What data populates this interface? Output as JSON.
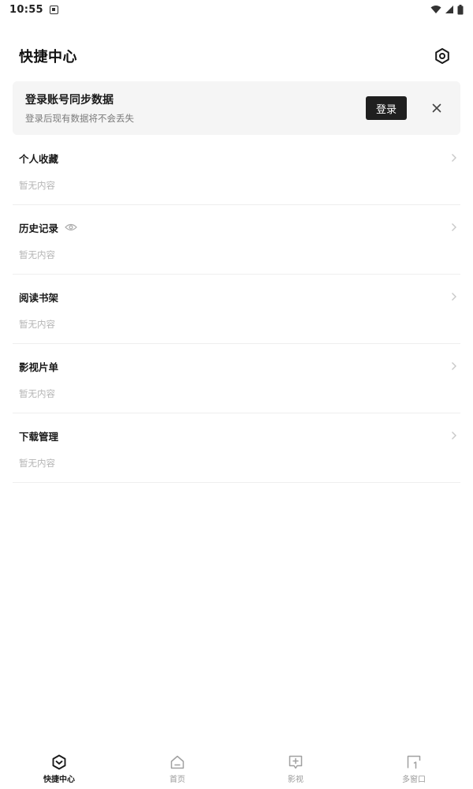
{
  "status_bar": {
    "time": "10:55"
  },
  "header": {
    "title": "快捷中心"
  },
  "login_banner": {
    "title": "登录账号同步数据",
    "subtitle": "登录后现有数据将不会丢失",
    "login_label": "登录"
  },
  "sections": [
    {
      "title": "个人收藏",
      "empty": "暂无内容"
    },
    {
      "title": "历史记录",
      "empty": "暂无内容"
    },
    {
      "title": "阅读书架",
      "empty": "暂无内容"
    },
    {
      "title": "影视片单",
      "empty": "暂无内容"
    },
    {
      "title": "下载管理",
      "empty": "暂无内容"
    }
  ],
  "bottom_nav": [
    {
      "label": "快捷中心",
      "icon": "shortcut-center-icon",
      "active": true
    },
    {
      "label": "首页",
      "icon": "home-icon",
      "active": false
    },
    {
      "label": "影视",
      "icon": "video-icon",
      "active": false
    },
    {
      "label": "多窗口",
      "icon": "multi-window-icon",
      "active": false
    }
  ],
  "colors": {
    "accent": "#1f1f1f",
    "banner_bg": "#f5f5f5",
    "muted_text": "#b5b5b5"
  }
}
